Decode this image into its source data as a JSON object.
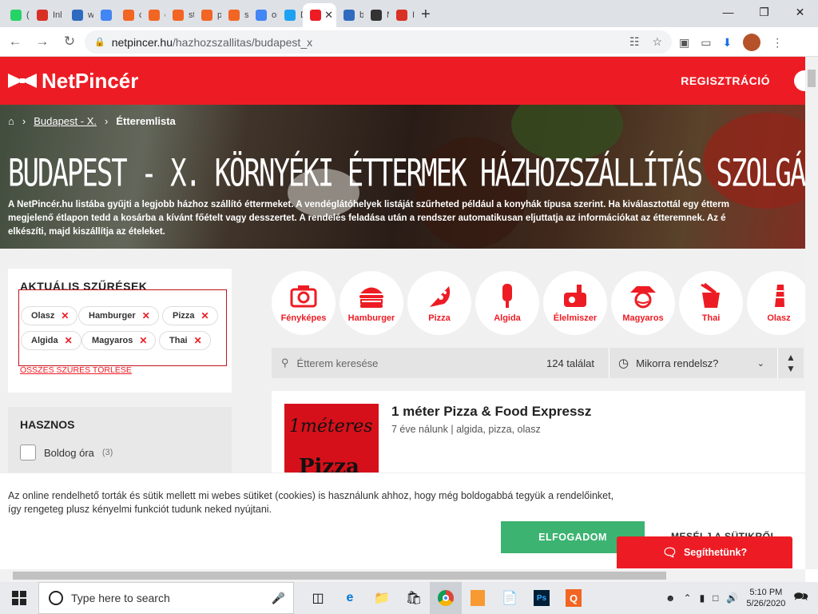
{
  "browser": {
    "tabs": [
      {
        "label": "(13",
        "color": "#25d366",
        "icon": "whatsapp-icon"
      },
      {
        "label": "Inl",
        "color": "#d93025",
        "icon": "gmail-icon"
      },
      {
        "label": "wh",
        "color": "#2f6bbf",
        "icon": "infinity-icon"
      },
      {
        "label": "Be",
        "color": "#4285f4",
        "icon": "docs-icon"
      },
      {
        "label": "cP",
        "color": "#f26522",
        "icon": "cp-icon"
      },
      {
        "label": "cP",
        "color": "#f26522",
        "icon": "cp-icon"
      },
      {
        "label": "str",
        "color": "#f26522",
        "icon": "cp-icon"
      },
      {
        "label": "pro",
        "color": "#f26522",
        "icon": "cp-icon"
      },
      {
        "label": "sty",
        "color": "#f26522",
        "icon": "cp-icon"
      },
      {
        "label": "on",
        "color": "#4285f4",
        "icon": "google-icon"
      },
      {
        "label": "De",
        "color": "#1da1f2",
        "icon": "y-icon"
      },
      {
        "label": "",
        "color": "#ed1c24",
        "icon": "netpincer-icon",
        "active": true
      },
      {
        "label": "be",
        "color": "#2f6bbf",
        "icon": "infinity-icon"
      },
      {
        "label": "Ne",
        "color": "#333333",
        "icon": "wikipedia-icon"
      },
      {
        "label": "Inl",
        "color": "#d93025",
        "icon": "gmail-icon"
      }
    ],
    "url_host": "netpincer.hu",
    "url_path": "/hazhozszallitas/budapest_x"
  },
  "site": {
    "logo": "NetPincér",
    "register": "REGISZTRÁCIÓ",
    "breadcrumb": {
      "level1": "Budapest - X.",
      "current": "Étteremlista"
    },
    "title": "BUDAPEST - X. KÖRNYÉKI ÉTTERMEK HÁZHOZSZÁLLÍTÁS SZOLGÁLTATÁSSAL",
    "desc_lines": [
      "A NetPincér.hu listába gyűjti a legjobb házhoz szállító éttermeket. A vendéglátóhelyek listáját szűrheted például a konyhák típusa szerint. Ha kiválasztottál egy étterm",
      "megjelenő étlapon tedd a kosárba a kívánt főételt vagy desszertet. A rendelés feladása után a rendszer automatikusan eljuttatja az információkat az étteremnek. Az é",
      "elkészíti, majd kiszállítja az ételeket."
    ],
    "filters": {
      "title": "AKTUÁLIS SZŰRÉSEK",
      "chips": [
        "Olasz",
        "Hamburger",
        "Pizza",
        "Algida",
        "Magyaros",
        "Thai"
      ],
      "clear": "ÖSSZES SZŰRÉS TÖRLÉSE"
    },
    "useful": {
      "title": "HASZNOS",
      "option_label": "Boldog óra",
      "option_count": "(3)"
    },
    "categories": [
      "Fényképes",
      "Hamburger",
      "Pizza",
      "Algida",
      "Élelmiszer",
      "Magyaros",
      "Thai",
      "Olasz"
    ],
    "search": {
      "placeholder": "Étterem keresése",
      "count": "124 találat",
      "when": "Mikorra rendelsz?"
    },
    "restaurant": {
      "name": "1 méter Pizza & Food Expressz",
      "meta": "7 éve nálunk | algida, pizza, olasz",
      "thumb_line1": "1méteres",
      "thumb_line2": "Pizza"
    },
    "cookie": {
      "text": "Az online rendelhető torták és sütik mellett mi webes sütiket (cookies) is használunk ahhoz, hogy még boldogabbá tegyük a rendelőinket, így rengeteg plusz kényelmi funkciót tudunk neked nyújtani.",
      "accept": "ELFOGADOM",
      "more": "MESÉLJ A SÜTIKRŐL"
    },
    "help": "Segíthetünk?",
    "brand_color": "#ed1c24"
  },
  "taskbar": {
    "search_placeholder": "Type here to search",
    "time": "5:10 PM",
    "date": "5/26/2020"
  }
}
